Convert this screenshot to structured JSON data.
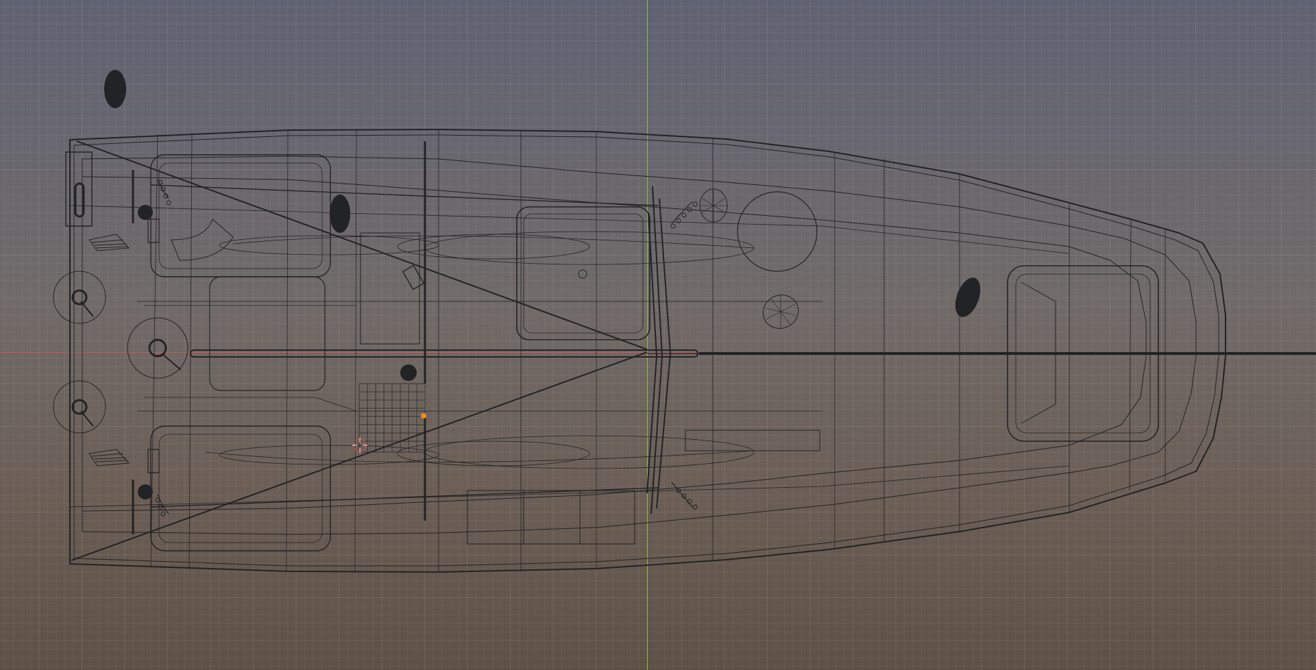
{
  "viewport": {
    "view": "top-orthographic",
    "mode": "wireframe",
    "object": "sailboat-hull"
  },
  "colors": {
    "bg_top": "#5f6272",
    "bg_bottom": "#5e5046",
    "wire": "#222325",
    "axis_x": "#c65a5a",
    "axis_y": "#8cbf3a",
    "origin": "#f08a1e",
    "cursor_red": "#e04040",
    "cursor_white": "#ffffff"
  }
}
